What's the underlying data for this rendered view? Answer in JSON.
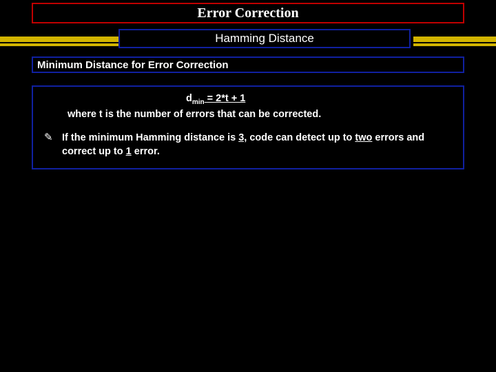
{
  "title": "Error Correction",
  "subtitle": "Hamming Distance",
  "section_heading": "Minimum Distance for Error Correction",
  "formula": {
    "d": "d",
    "sub": "min",
    "eq": " = 2*t + 1"
  },
  "where_line": "where t is the number of errors that can be corrected.",
  "bullet": {
    "icon": "✎",
    "pre": "If the minimum Hamming distance is ",
    "v1": "3,",
    "mid1": " code can detect up to ",
    "v2": "two",
    "mid2": " errors and correct up to ",
    "v3": "1",
    "post": " error."
  }
}
